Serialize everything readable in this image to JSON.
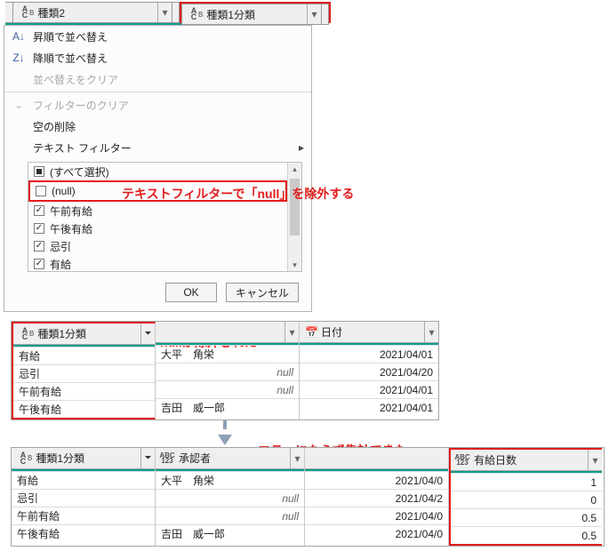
{
  "top_headers": {
    "col1": "種類2",
    "col2": "種類1分類"
  },
  "menu": {
    "sort_asc": "昇順で並べ替え",
    "sort_desc": "降順で並べ替え",
    "clear_sort": "並べ替えをクリア",
    "clear_filter": "フィルターのクリア",
    "remove_empty": "空の削除",
    "text_filter": "テキスト フィルター"
  },
  "checklist": {
    "select_all": "(すべて選択)",
    "items": [
      {
        "label": "(null)",
        "checked": false
      },
      {
        "label": "午前有給",
        "checked": true
      },
      {
        "label": "午後有給",
        "checked": true
      },
      {
        "label": "忌引",
        "checked": true
      },
      {
        "label": "有給",
        "checked": true
      }
    ]
  },
  "buttons": {
    "ok": "OK",
    "cancel": "キャンセル"
  },
  "annotations": {
    "exclude_null": "テキストフィルターで「null」を除外する",
    "null_excluded": "nullが除外された",
    "aggregated": "エラーにならず集計できた"
  },
  "table2": {
    "headers": {
      "col1": "種類1分類",
      "col2_blank": "",
      "col3": "日付"
    },
    "rows": [
      {
        "c1": "有給",
        "c2": "大平　角栄",
        "c2_null": false,
        "c3": "2021/04/01"
      },
      {
        "c1": "忌引",
        "c2": "null",
        "c2_null": true,
        "c3": "2021/04/20"
      },
      {
        "c1": "午前有給",
        "c2": "null",
        "c2_null": true,
        "c3": "2021/04/01"
      },
      {
        "c1": "午後有給",
        "c2": "吉田　威一郎",
        "c2_null": false,
        "c3": "2021/04/01"
      }
    ]
  },
  "table3": {
    "headers": {
      "col1": "種類1分類",
      "col2": "承認者",
      "col3_blank": "",
      "col4": "有給日数"
    },
    "rows": [
      {
        "c1": "有給",
        "c2": "大平　角栄",
        "c2_null": false,
        "c3": "2021/04/0",
        "c4": "1"
      },
      {
        "c1": "忌引",
        "c2": "null",
        "c2_null": true,
        "c3": "2021/04/2",
        "c4": "0"
      },
      {
        "c1": "午前有給",
        "c2": "null",
        "c2_null": true,
        "c3": "2021/04/0",
        "c4": "0.5"
      },
      {
        "c1": "午後有給",
        "c2": "吉田　威一郎",
        "c2_null": false,
        "c3": "2021/04/0",
        "c4": "0.5"
      }
    ]
  }
}
